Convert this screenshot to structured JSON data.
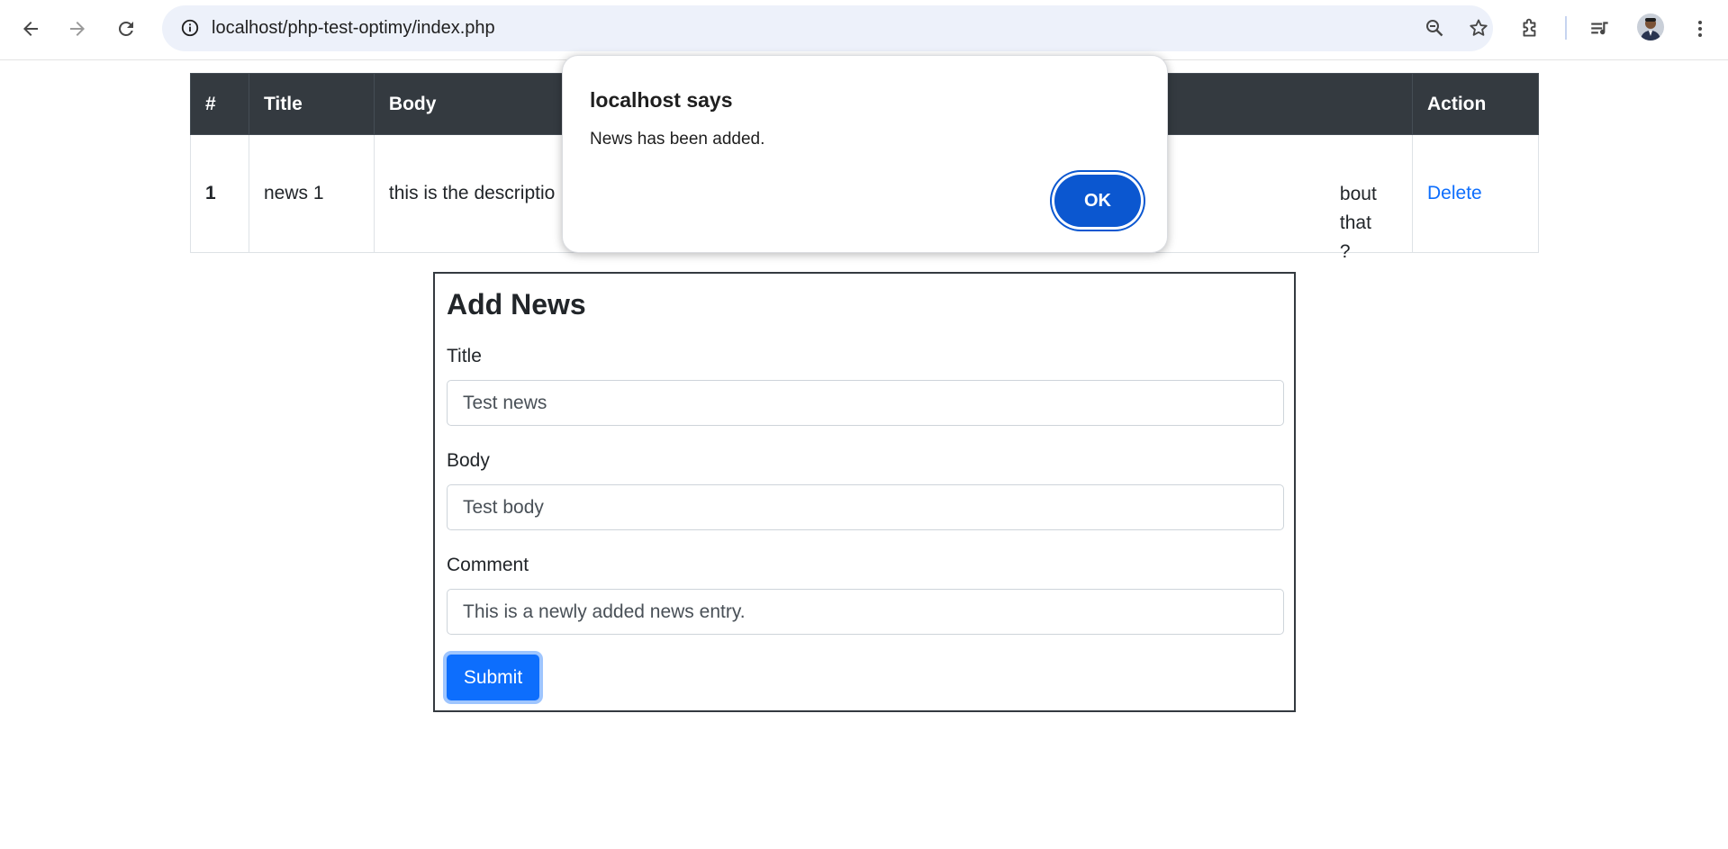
{
  "browser": {
    "url": "localhost/php-test-optimy/index.php",
    "icons": [
      "back-arrow-icon",
      "forward-arrow-icon",
      "reload-icon",
      "site-info-icon",
      "zoom-icon",
      "bookmark-star-icon",
      "extensions-icon",
      "media-control-icon",
      "avatar",
      "more-menu-icon"
    ]
  },
  "table": {
    "headers": [
      "#",
      "Title",
      "Body",
      "Action"
    ],
    "rows": [
      {
        "num": "1",
        "title": "news 1",
        "body_start": "this is the descriptio",
        "body_visible_tail_line1": "bout that",
        "body_visible_tail_line2": "?",
        "action": "Delete"
      }
    ]
  },
  "form": {
    "heading": "Add News",
    "title_label": "Title",
    "title_value": "Test news",
    "body_label": "Body",
    "body_value": "Test body",
    "comment_label": "Comment",
    "comment_value": "This is a newly added news entry.",
    "submit_label": "Submit"
  },
  "dialog": {
    "title": "localhost says",
    "message": "News has been added.",
    "ok_label": "OK"
  },
  "colors": {
    "table_header_bg": "#343a40",
    "link": "#0d6efd",
    "primary_button": "#0d6efd",
    "dialog_ok": "#0b57d0",
    "omnibox_bg": "#edf1fa"
  }
}
